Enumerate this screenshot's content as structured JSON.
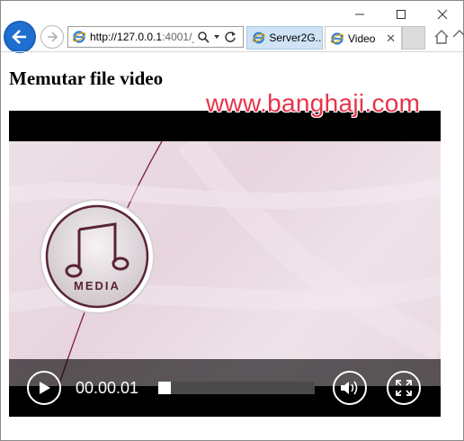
{
  "window": {
    "controls": [
      "minimize-icon",
      "maximize-icon",
      "close-icon"
    ]
  },
  "nav": {
    "address": {
      "host": "http://127.0.0.1",
      "rest": ":4001/_"
    },
    "tabs": [
      {
        "label": "Server2G...",
        "active": false
      },
      {
        "label": "Video",
        "active": true
      }
    ]
  },
  "page": {
    "title": "Memutar file video"
  },
  "watermark": "www.banghaji.com",
  "video": {
    "logo_text": "MEDIA",
    "current_time": "00.00.01",
    "progress": 0.0
  },
  "colors": {
    "back_button": "#1f6fd1",
    "watermark": "#e8344a",
    "frame_bg": "#ede0e8",
    "controls_bg": "#000000"
  }
}
